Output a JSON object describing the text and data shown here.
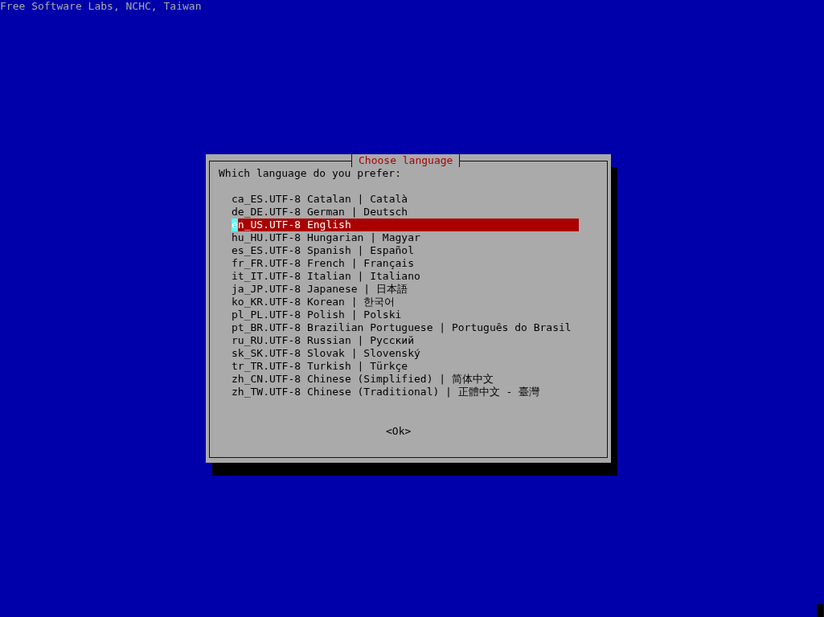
{
  "screen_header": "Free Software Labs, NCHC, Taiwan",
  "dialog": {
    "title": "Choose language",
    "prompt": "Which language do you prefer:",
    "items": [
      {
        "label": "ca_ES.UTF-8 Catalan | Català",
        "selected": false
      },
      {
        "label": "de_DE.UTF-8 German | Deutsch",
        "selected": false
      },
      {
        "label": "en_US.UTF-8 English",
        "selected": true
      },
      {
        "label": "hu_HU.UTF-8 Hungarian | Magyar",
        "selected": false
      },
      {
        "label": "es_ES.UTF-8 Spanish | Español",
        "selected": false
      },
      {
        "label": "fr_FR.UTF-8 French | Français",
        "selected": false
      },
      {
        "label": "it_IT.UTF-8 Italian | Italiano",
        "selected": false
      },
      {
        "label": "ja_JP.UTF-8 Japanese | 日本語",
        "selected": false
      },
      {
        "label": "ko_KR.UTF-8 Korean | 한국어",
        "selected": false
      },
      {
        "label": "pl_PL.UTF-8 Polish | Polski",
        "selected": false
      },
      {
        "label": "pt_BR.UTF-8 Brazilian Portuguese | Português do Brasil",
        "selected": false
      },
      {
        "label": "ru_RU.UTF-8 Russian | Русский",
        "selected": false
      },
      {
        "label": "sk_SK.UTF-8 Slovak | Slovenský",
        "selected": false
      },
      {
        "label": "tr_TR.UTF-8 Turkish | Türkçe",
        "selected": false
      },
      {
        "label": "zh_CN.UTF-8 Chinese (Simplified) | 简体中文",
        "selected": false
      },
      {
        "label": "zh_TW.UTF-8 Chinese (Traditional) | 正體中文 - 臺灣",
        "selected": false
      }
    ],
    "button": "<Ok>"
  }
}
